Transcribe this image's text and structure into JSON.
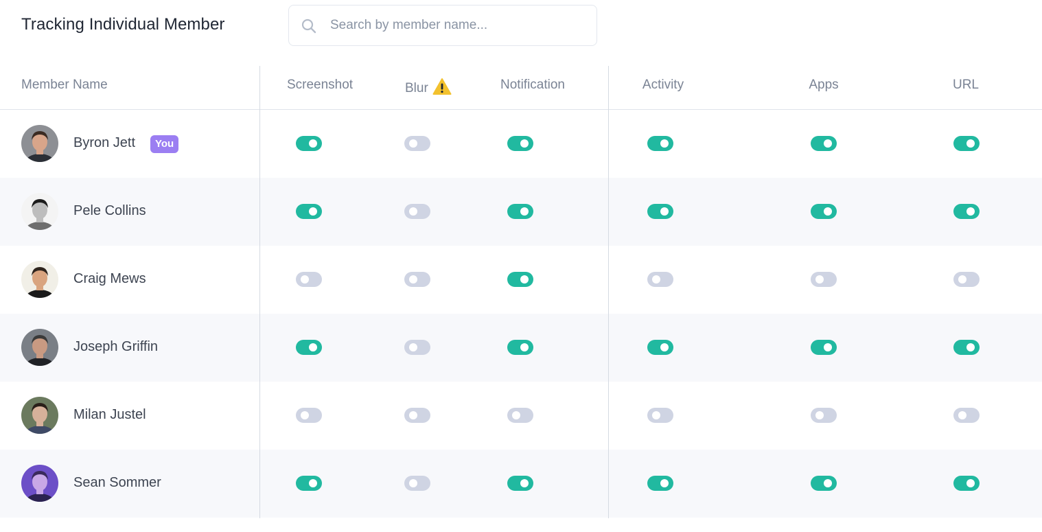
{
  "header": {
    "title": "Tracking Individual Member",
    "search_placeholder": "Search by member name...",
    "search_value": ""
  },
  "columns": [
    {
      "key": "member",
      "label": "Member Name"
    },
    {
      "key": "screenshot",
      "label": "Screenshot"
    },
    {
      "key": "blur",
      "label": "Blur",
      "icon": "warning-icon"
    },
    {
      "key": "notification",
      "label": "Notification"
    },
    {
      "key": "activity",
      "label": "Activity"
    },
    {
      "key": "apps",
      "label": "Apps"
    },
    {
      "key": "url",
      "label": "URL"
    }
  ],
  "you_badge": "You",
  "colors": {
    "toggle_on": "#21b9a0",
    "toggle_off": "#cfd4e3",
    "you_badge": "#9b7ef2",
    "warning": "#f2c12e"
  },
  "members": [
    {
      "name": "Byron Jett",
      "is_you": true,
      "avatar": "avatar-photo",
      "toggles": {
        "screenshot": true,
        "blur": false,
        "notification": true,
        "activity": true,
        "apps": true,
        "url": true
      }
    },
    {
      "name": "Pele Collins",
      "is_you": false,
      "avatar": "avatar-photo",
      "toggles": {
        "screenshot": true,
        "blur": false,
        "notification": true,
        "activity": true,
        "apps": true,
        "url": true
      }
    },
    {
      "name": "Craig Mews",
      "is_you": false,
      "avatar": "avatar-photo",
      "toggles": {
        "screenshot": false,
        "blur": false,
        "notification": true,
        "activity": false,
        "apps": false,
        "url": false
      }
    },
    {
      "name": "Joseph Griffin",
      "is_you": false,
      "avatar": "avatar-photo",
      "toggles": {
        "screenshot": true,
        "blur": false,
        "notification": true,
        "activity": true,
        "apps": true,
        "url": true
      }
    },
    {
      "name": "Milan Justel",
      "is_you": false,
      "avatar": "avatar-photo",
      "toggles": {
        "screenshot": false,
        "blur": false,
        "notification": false,
        "activity": false,
        "apps": false,
        "url": false
      }
    },
    {
      "name": "Sean Sommer",
      "is_you": false,
      "avatar": "avatar-photo",
      "toggles": {
        "screenshot": true,
        "blur": false,
        "notification": true,
        "activity": true,
        "apps": true,
        "url": true
      }
    }
  ]
}
